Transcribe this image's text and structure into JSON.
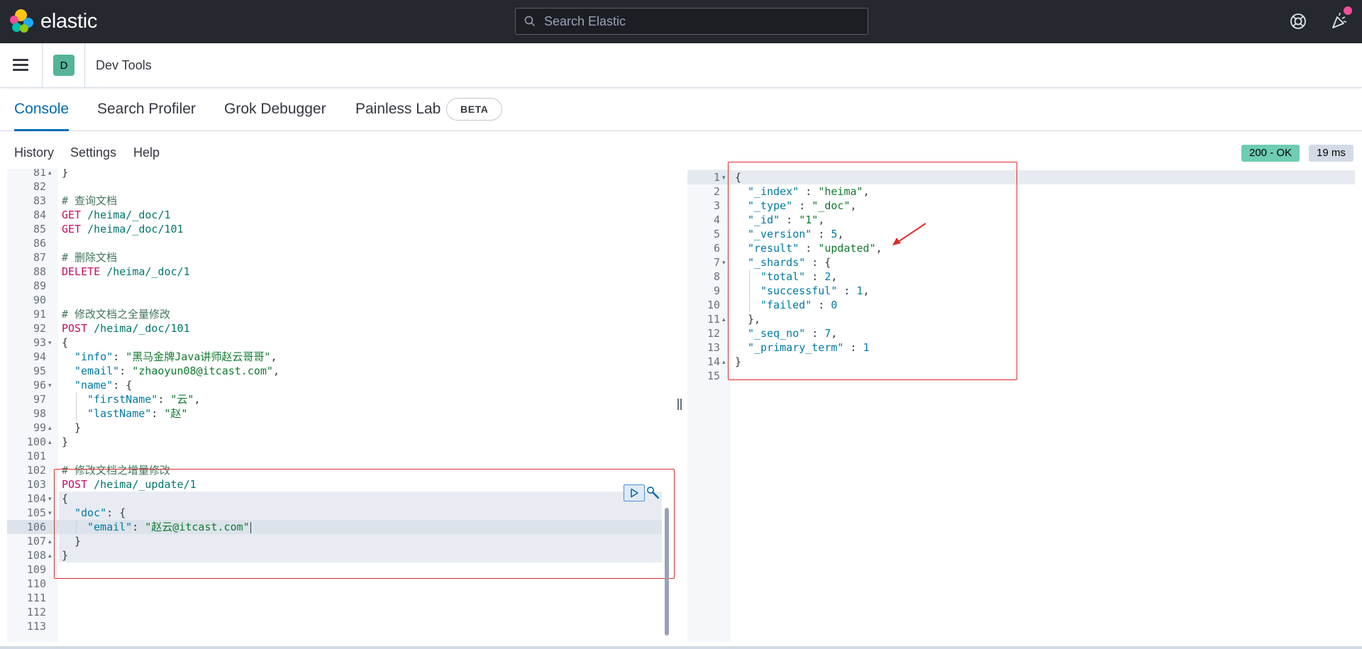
{
  "app": {
    "brand": "elastic",
    "search_placeholder": "Search Elastic",
    "breadcrumb_avatar": "D",
    "breadcrumb_title": "Dev Tools"
  },
  "tabs": [
    {
      "label": "Console",
      "active": true
    },
    {
      "label": "Search Profiler",
      "active": false
    },
    {
      "label": "Grok Debugger",
      "active": false
    },
    {
      "label": "Painless Lab",
      "active": false
    }
  ],
  "beta_badge": "BETA",
  "toolbar": {
    "history": "History",
    "settings": "Settings",
    "help": "Help"
  },
  "response_status": {
    "status": "200 - OK",
    "time": "19 ms"
  },
  "request_editor": {
    "active_line": 106,
    "lines": [
      {
        "n": "81",
        "fold": "▴",
        "indent": 0,
        "t": [
          [
            "c-punc",
            "}"
          ]
        ]
      },
      {
        "n": "82",
        "indent": 0,
        "t": []
      },
      {
        "n": "83",
        "indent": 0,
        "t": [
          [
            "c-comment",
            "# 查询文档"
          ]
        ]
      },
      {
        "n": "84",
        "indent": 0,
        "t": [
          [
            "c-method",
            "GET"
          ],
          [
            "c-url",
            " /heima/_doc/1"
          ]
        ]
      },
      {
        "n": "85",
        "indent": 0,
        "t": [
          [
            "c-method",
            "GET"
          ],
          [
            "c-url",
            " /heima/_doc/101"
          ]
        ]
      },
      {
        "n": "86",
        "indent": 0,
        "t": []
      },
      {
        "n": "87",
        "indent": 0,
        "t": [
          [
            "c-comment",
            "# 删除文档"
          ]
        ]
      },
      {
        "n": "88",
        "indent": 0,
        "t": [
          [
            "c-method",
            "DELETE"
          ],
          [
            "c-url",
            " /heima/_doc/1"
          ]
        ]
      },
      {
        "n": "89",
        "indent": 0,
        "t": []
      },
      {
        "n": "90",
        "indent": 0,
        "t": []
      },
      {
        "n": "91",
        "indent": 0,
        "t": [
          [
            "c-comment",
            "# 修改文档之全量修改"
          ]
        ]
      },
      {
        "n": "92",
        "indent": 0,
        "t": [
          [
            "c-method",
            "POST"
          ],
          [
            "c-url",
            " /heima/_doc/101"
          ]
        ]
      },
      {
        "n": "93",
        "fold": "▾",
        "indent": 0,
        "t": [
          [
            "c-punc",
            "{"
          ]
        ]
      },
      {
        "n": "94",
        "indent": 1,
        "t": [
          [
            "c-key",
            "\"info\""
          ],
          [
            "c-punc",
            ": "
          ],
          [
            "c-str",
            "\"黑马金牌Java讲师赵云哥哥\""
          ],
          [
            "c-punc",
            ","
          ]
        ]
      },
      {
        "n": "95",
        "indent": 1,
        "t": [
          [
            "c-key",
            "\"email\""
          ],
          [
            "c-punc",
            ": "
          ],
          [
            "c-str",
            "\"zhaoyun08@itcast.com\""
          ],
          [
            "c-punc",
            ","
          ]
        ]
      },
      {
        "n": "96",
        "fold": "▾",
        "indent": 1,
        "t": [
          [
            "c-key",
            "\"name\""
          ],
          [
            "c-punc",
            ": {"
          ]
        ]
      },
      {
        "n": "97",
        "indent": 2,
        "t": [
          [
            "c-key",
            "\"firstName\""
          ],
          [
            "c-punc",
            ": "
          ],
          [
            "c-str",
            "\"云\""
          ],
          [
            "c-punc",
            ","
          ]
        ]
      },
      {
        "n": "98",
        "indent": 2,
        "t": [
          [
            "c-key",
            "\"lastName\""
          ],
          [
            "c-punc",
            ": "
          ],
          [
            "c-str",
            "\"赵\""
          ]
        ]
      },
      {
        "n": "99",
        "fold": "▴",
        "indent": 1,
        "t": [
          [
            "c-punc",
            "}"
          ]
        ]
      },
      {
        "n": "100",
        "fold": "▴",
        "indent": 0,
        "t": [
          [
            "c-punc",
            "}"
          ]
        ]
      },
      {
        "n": "101",
        "indent": 0,
        "t": []
      },
      {
        "n": "102",
        "indent": 0,
        "t": [
          [
            "c-comment",
            "# 修改文档之增量修改"
          ]
        ]
      },
      {
        "n": "103",
        "indent": 0,
        "t": [
          [
            "c-method",
            "POST"
          ],
          [
            "c-url",
            " /heima/_update/1"
          ]
        ]
      },
      {
        "n": "104",
        "fold": "▾",
        "indent": 0,
        "t": [
          [
            "c-punc",
            "{"
          ]
        ]
      },
      {
        "n": "105",
        "fold": "▾",
        "indent": 1,
        "t": [
          [
            "c-key",
            "\"doc\""
          ],
          [
            "c-punc",
            ": {"
          ]
        ]
      },
      {
        "n": "106",
        "indent": 2,
        "t": [
          [
            "c-key",
            "\"email\""
          ],
          [
            "c-punc",
            ": "
          ],
          [
            "c-str",
            "\"赵云@itcast.com\""
          ]
        ]
      },
      {
        "n": "107",
        "fold": "▴",
        "indent": 1,
        "t": [
          [
            "c-punc",
            "}"
          ]
        ]
      },
      {
        "n": "108",
        "fold": "▴",
        "indent": 0,
        "t": [
          [
            "c-punc",
            "}"
          ]
        ]
      },
      {
        "n": "109",
        "indent": 0,
        "t": []
      },
      {
        "n": "110",
        "indent": 0,
        "t": []
      },
      {
        "n": "111",
        "indent": 0,
        "t": []
      },
      {
        "n": "112",
        "indent": 0,
        "t": []
      },
      {
        "n": "113",
        "indent": 0,
        "t": []
      }
    ]
  },
  "response_editor": {
    "lines": [
      {
        "n": "1",
        "fold": "▾",
        "indent": 0,
        "t": [
          [
            "c-punc",
            "{"
          ]
        ]
      },
      {
        "n": "2",
        "indent": 1,
        "t": [
          [
            "c-key",
            "\"_index\""
          ],
          [
            "c-punc",
            " : "
          ],
          [
            "c-str",
            "\"heima\""
          ],
          [
            "c-punc",
            ","
          ]
        ]
      },
      {
        "n": "3",
        "indent": 1,
        "t": [
          [
            "c-key",
            "\"_type\""
          ],
          [
            "c-punc",
            " : "
          ],
          [
            "c-str",
            "\"_doc\""
          ],
          [
            "c-punc",
            ","
          ]
        ]
      },
      {
        "n": "4",
        "indent": 1,
        "t": [
          [
            "c-key",
            "\"_id\""
          ],
          [
            "c-punc",
            " : "
          ],
          [
            "c-str",
            "\"1\""
          ],
          [
            "c-punc",
            ","
          ]
        ]
      },
      {
        "n": "5",
        "indent": 1,
        "t": [
          [
            "c-key",
            "\"_version\""
          ],
          [
            "c-punc",
            " : "
          ],
          [
            "c-num",
            "5"
          ],
          [
            "c-punc",
            ","
          ]
        ]
      },
      {
        "n": "6",
        "indent": 1,
        "t": [
          [
            "c-key",
            "\"result\""
          ],
          [
            "c-punc",
            " : "
          ],
          [
            "c-str",
            "\"updated\""
          ],
          [
            "c-punc",
            ","
          ]
        ]
      },
      {
        "n": "7",
        "fold": "▾",
        "indent": 1,
        "t": [
          [
            "c-key",
            "\"_shards\""
          ],
          [
            "c-punc",
            " : {"
          ]
        ]
      },
      {
        "n": "8",
        "indent": 2,
        "t": [
          [
            "c-key",
            "\"total\""
          ],
          [
            "c-punc",
            " : "
          ],
          [
            "c-num",
            "2"
          ],
          [
            "c-punc",
            ","
          ]
        ]
      },
      {
        "n": "9",
        "indent": 2,
        "t": [
          [
            "c-key",
            "\"successful\""
          ],
          [
            "c-punc",
            " : "
          ],
          [
            "c-num",
            "1"
          ],
          [
            "c-punc",
            ","
          ]
        ]
      },
      {
        "n": "10",
        "indent": 2,
        "t": [
          [
            "c-key",
            "\"failed\""
          ],
          [
            "c-punc",
            " : "
          ],
          [
            "c-num",
            "0"
          ]
        ]
      },
      {
        "n": "11",
        "fold": "▴",
        "indent": 1,
        "t": [
          [
            "c-punc",
            "},"
          ]
        ]
      },
      {
        "n": "12",
        "indent": 1,
        "t": [
          [
            "c-key",
            "\"_seq_no\""
          ],
          [
            "c-punc",
            " : "
          ],
          [
            "c-num",
            "7"
          ],
          [
            "c-punc",
            ","
          ]
        ]
      },
      {
        "n": "13",
        "indent": 1,
        "t": [
          [
            "c-key",
            "\"_primary_term\""
          ],
          [
            "c-punc",
            " : "
          ],
          [
            "c-num",
            "1"
          ]
        ]
      },
      {
        "n": "14",
        "fold": "▴",
        "indent": 0,
        "t": [
          [
            "c-punc",
            "}"
          ]
        ]
      },
      {
        "n": "15",
        "indent": 0,
        "t": []
      }
    ]
  },
  "colors": {
    "accent": "#006bb4",
    "status_ok": "#6dccb1",
    "annotation": "#e02b2b"
  }
}
